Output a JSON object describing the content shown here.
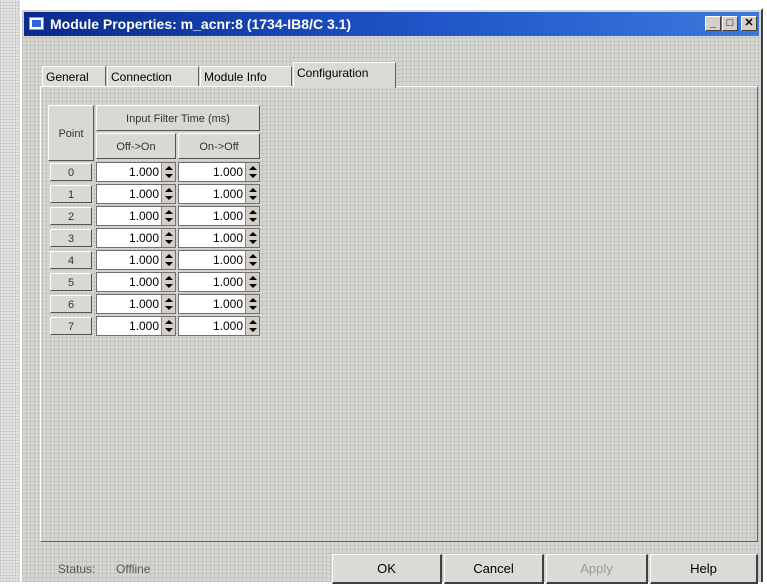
{
  "window": {
    "title": "Module Properties: m_acnr:8 (1734-IB8/C 3.1)",
    "controls": {
      "minimize": "_",
      "maximize": "□",
      "close": "✕"
    }
  },
  "tabs": [
    {
      "label": "General",
      "active": false
    },
    {
      "label": "Connection",
      "active": false
    },
    {
      "label": "Module Info",
      "active": false
    },
    {
      "label": "Configuration",
      "active": true
    }
  ],
  "grid": {
    "point_header": "Point",
    "filter_header": "Input Filter Time (ms)",
    "off_on_header": "Off->On",
    "on_off_header": "On->Off",
    "rows": [
      {
        "point": "0",
        "off_on": "1.000",
        "on_off": "1.000"
      },
      {
        "point": "1",
        "off_on": "1.000",
        "on_off": "1.000"
      },
      {
        "point": "2",
        "off_on": "1.000",
        "on_off": "1.000"
      },
      {
        "point": "3",
        "off_on": "1.000",
        "on_off": "1.000"
      },
      {
        "point": "4",
        "off_on": "1.000",
        "on_off": "1.000"
      },
      {
        "point": "5",
        "off_on": "1.000",
        "on_off": "1.000"
      },
      {
        "point": "6",
        "off_on": "1.000",
        "on_off": "1.000"
      },
      {
        "point": "7",
        "off_on": "1.000",
        "on_off": "1.000"
      }
    ]
  },
  "status": {
    "label": "Status:",
    "value": "Offline"
  },
  "buttons": {
    "ok": "OK",
    "cancel": "Cancel",
    "apply": "Apply",
    "help": "Help"
  }
}
